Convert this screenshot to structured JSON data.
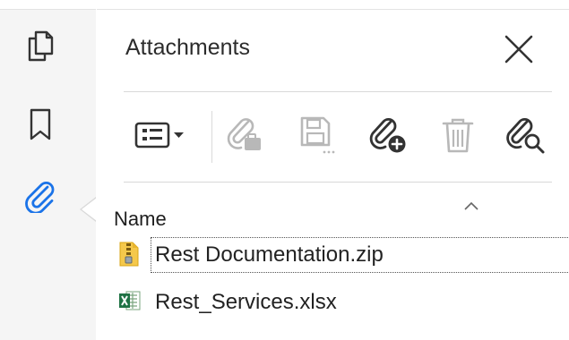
{
  "colors": {
    "accent": "#1a73e8",
    "icon_dark": "#333333",
    "icon_disabled": "#b8b8b8",
    "rail_bg": "#f5f5f5"
  },
  "rail": {
    "items": [
      {
        "name": "pages",
        "icon": "pages-icon"
      },
      {
        "name": "bookmarks",
        "icon": "bookmark-icon"
      },
      {
        "name": "attachments",
        "icon": "paperclip-icon",
        "active": true
      }
    ]
  },
  "panel": {
    "title": "Attachments",
    "close_icon": "close-icon"
  },
  "toolbar": {
    "items": [
      {
        "icon": "options-menu-icon",
        "enabled": true
      },
      {
        "icon": "open-attachment-icon",
        "enabled": false
      },
      {
        "icon": "save-attachment-icon",
        "enabled": false
      },
      {
        "icon": "add-attachment-icon",
        "enabled": true
      },
      {
        "icon": "delete-attachment-icon",
        "enabled": false
      },
      {
        "icon": "search-attachment-icon",
        "enabled": true
      }
    ]
  },
  "list": {
    "column_header": "Name",
    "sort_icon": "sort-ascending-icon",
    "rows": [
      {
        "name": "Rest Documentation.zip",
        "icon": "zip-file-icon",
        "selected": true
      },
      {
        "name": "Rest_Services.xlsx",
        "icon": "excel-file-icon",
        "selected": false
      }
    ]
  }
}
